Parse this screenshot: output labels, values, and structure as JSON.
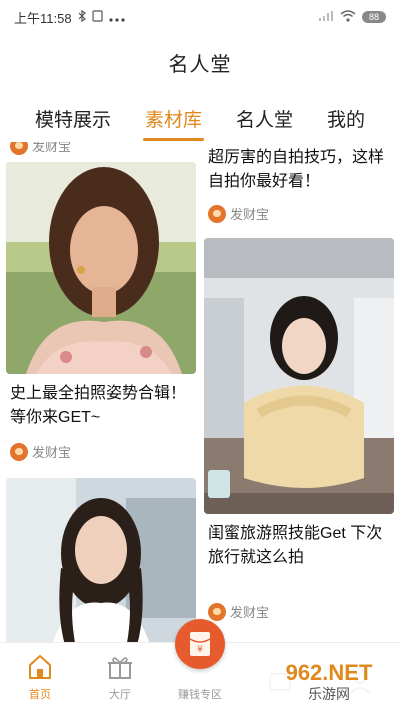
{
  "status_bar": {
    "time": "上午11:58",
    "battery": "88"
  },
  "header": {
    "title": "名人堂"
  },
  "tabs": [
    {
      "label": "模特展示",
      "active": false
    },
    {
      "label": "素材库",
      "active": true
    },
    {
      "label": "名人堂",
      "active": false
    },
    {
      "label": "我的",
      "active": false
    }
  ],
  "feed": {
    "left": [
      {
        "author": "发财宝"
      },
      {
        "title": "史上最全拍照姿势合辑！等你来GET~",
        "author": "发财宝"
      }
    ],
    "right": [
      {
        "title": "超厉害的自拍技巧，这样自拍你最好看！",
        "author": "发财宝"
      },
      {
        "title": "闺蜜旅游照技能Get 下次旅行就这么拍",
        "author": "发财宝"
      }
    ]
  },
  "bottom_nav": [
    {
      "label": "首页",
      "icon": "home-icon",
      "active": true
    },
    {
      "label": "大厅",
      "icon": "gift-icon",
      "active": false
    },
    {
      "label": "赚钱专区",
      "icon": "red-envelope-icon",
      "active": false
    },
    {
      "label": "",
      "icon": "message-icon",
      "active": false
    },
    {
      "label": "",
      "icon": "profile-icon",
      "active": false
    }
  ],
  "watermark": {
    "text": "962.NET",
    "sub": "乐游网"
  },
  "colors": {
    "accent": "#e08a1e",
    "red": "#e55b2d"
  }
}
